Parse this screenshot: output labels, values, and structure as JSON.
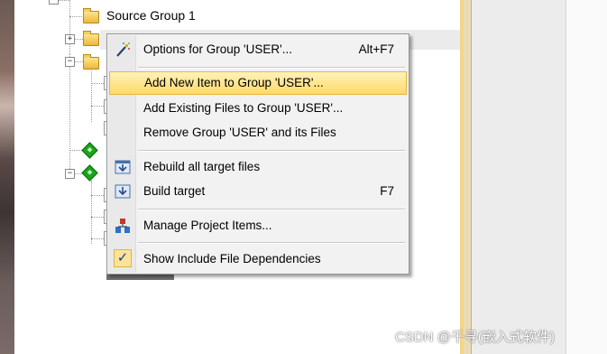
{
  "tree": {
    "source_group_label": "Source Group 1",
    "expander_plus": "+",
    "expander_minus": "−"
  },
  "menu": {
    "items": [
      {
        "label": "Options for Group 'USER'...",
        "shortcut": "Alt+F7",
        "icon": "wand-icon"
      },
      {
        "label": "Add New  Item to Group 'USER'...",
        "shortcut": "",
        "icon": "",
        "highlighted": true
      },
      {
        "label": "Add Existing Files to Group 'USER'...",
        "shortcut": "",
        "icon": ""
      },
      {
        "label": "Remove Group 'USER' and its Files",
        "shortcut": "",
        "icon": ""
      },
      {
        "label": "Rebuild all target files",
        "shortcut": "",
        "icon": "rebuild-icon"
      },
      {
        "label": "Build target",
        "shortcut": "F7",
        "icon": "build-icon"
      },
      {
        "label": "Manage Project Items...",
        "shortcut": "",
        "icon": "manage-items-icon"
      },
      {
        "label": "Show Include File Dependencies",
        "shortcut": "",
        "icon": "checkmark-icon",
        "checked": true
      }
    ]
  },
  "watermark": "CSDN @千寻(嵌入式软件)",
  "colors": {
    "highlight": "#ffd96a",
    "menu_bg": "#f2f2f2"
  }
}
